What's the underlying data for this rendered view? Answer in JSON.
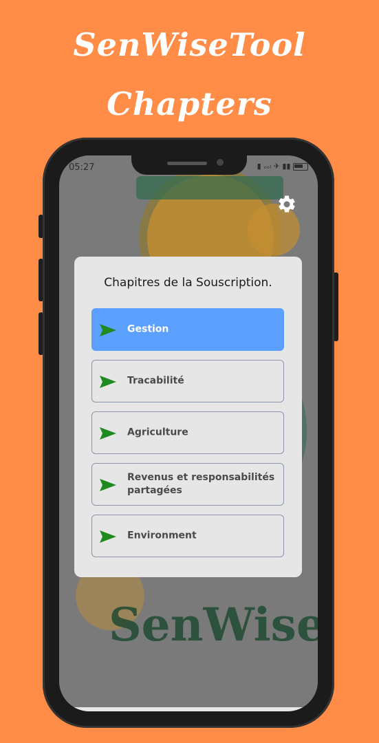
{
  "promo": {
    "line1": "SenWiseTool",
    "line2": "Chapters"
  },
  "status_bar": {
    "time": "05:27",
    "icons": "▮ ᵥₒₗ ✈ ▮▮"
  },
  "settings": {
    "icon": "gear-icon"
  },
  "dialog": {
    "title": "Chapitres de la Souscription.",
    "chapters": [
      {
        "label": "Gestion",
        "active": true
      },
      {
        "label": "Tracabilité",
        "active": false
      },
      {
        "label": "Agriculture",
        "active": false
      },
      {
        "label": "Revenus et responsabilités partagées",
        "active": false
      },
      {
        "label": "Environment",
        "active": false
      }
    ]
  },
  "background_logo": {
    "text": "SenWiseTool"
  },
  "colors": {
    "page_background": "#ff8c47",
    "active_chapter": "#5ca0ff",
    "arrow_green": "#1f8a1f",
    "dialog_background": "#e6e6e6"
  }
}
